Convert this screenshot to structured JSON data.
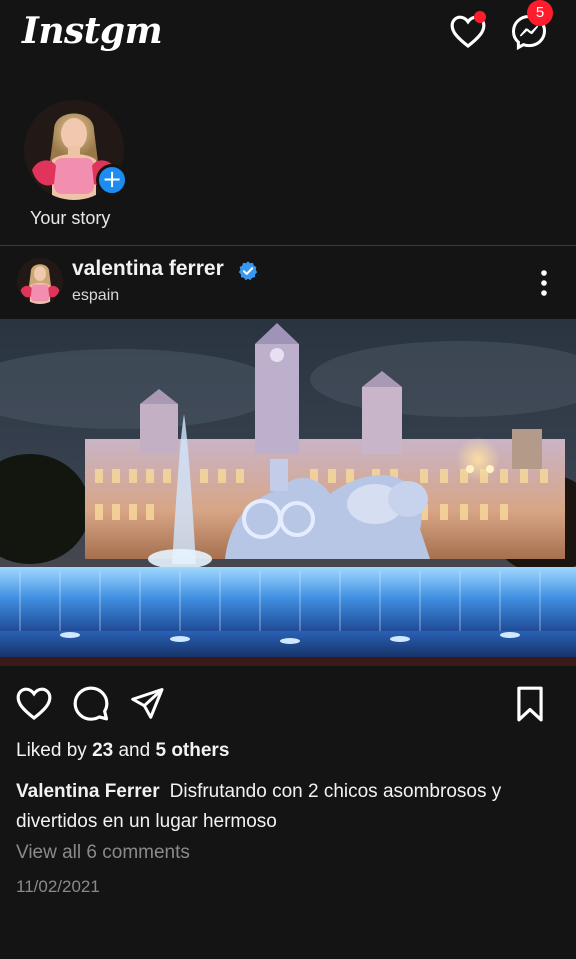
{
  "header": {
    "logo": "Instgm",
    "notifications_dot": true,
    "messages_badge": "5",
    "accent": "#ff1d2d"
  },
  "story": {
    "label": "Your story",
    "add_icon": "plus-icon",
    "add_color": "#1d8cf0"
  },
  "post": {
    "username": "valentina ferrer",
    "verified": true,
    "location": "espain",
    "image_subject": "illuminated palace with fountain at night",
    "likes_prefix": "Liked by",
    "likes_count": "23",
    "likes_and": "and",
    "likes_others": "5 others",
    "caption_user": "Valentina Ferrer",
    "caption_text": "Disfrutando con 2 chicos asombrosos y divertidos en un lugar hermoso",
    "comments_link": "View all 6 comments",
    "date": "11/02/2021"
  },
  "icons": {
    "like": "heart-icon",
    "comment": "comment-icon",
    "share": "send-icon",
    "save": "bookmark-icon",
    "more": "more-vertical-icon",
    "messenger": "messenger-icon",
    "verified": "verified-badge-icon"
  }
}
